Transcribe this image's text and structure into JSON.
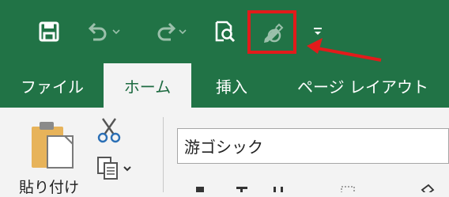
{
  "colors": {
    "title_bar": "#217346",
    "ribbon": "#f3f3f3",
    "highlight": "#e21b1b",
    "accent": "#1e6b41"
  },
  "quick_access": {
    "items": [
      {
        "icon": "save-icon"
      },
      {
        "icon": "undo-icon"
      },
      {
        "icon": "redo-icon"
      },
      {
        "icon": "print-preview-icon"
      },
      {
        "icon": "draw-pen-icon"
      },
      {
        "icon": "customize-dropdown-icon"
      }
    ]
  },
  "tabs": [
    "ファイル",
    "ホーム",
    "挿入",
    "ページ レイアウト"
  ],
  "active_tab": "ホーム",
  "ribbon": {
    "paste_label": "貼り付け",
    "font_name": "游ゴシック"
  }
}
